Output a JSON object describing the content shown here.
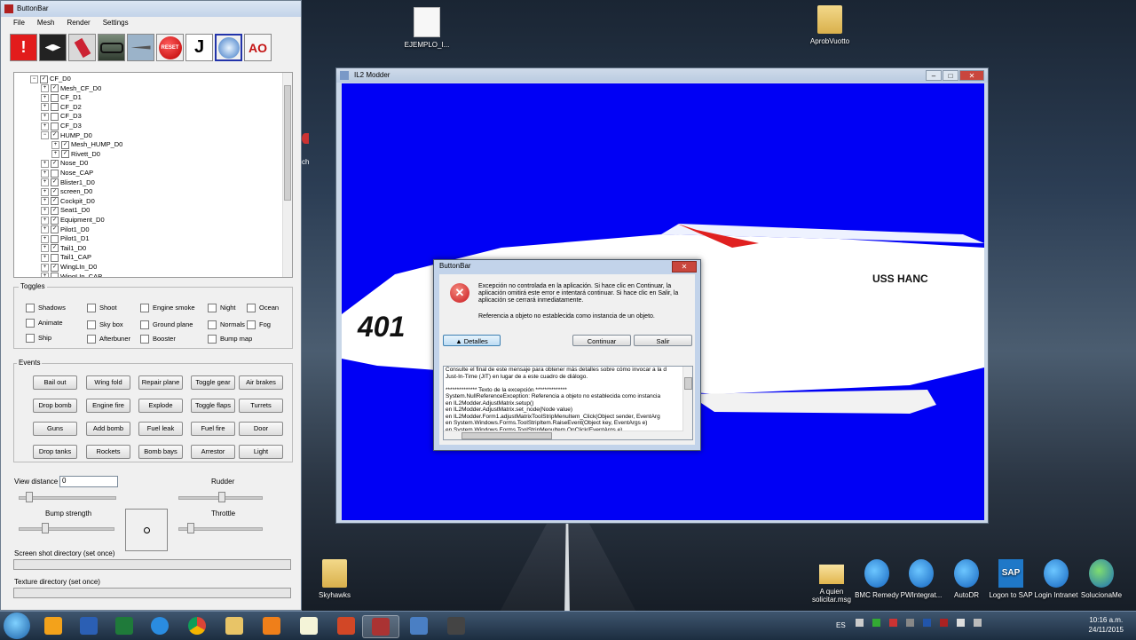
{
  "desktop": {
    "icons": [
      {
        "label": "EJEMPLO_I...",
        "kind": "file"
      },
      {
        "label": "AprobVuotto",
        "kind": "folder"
      },
      {
        "label": "Skyhawks",
        "kind": "folder"
      },
      {
        "label": "A quien solicitar.msg",
        "kind": "mail"
      },
      {
        "label": "BMC Remedy",
        "kind": "ie"
      },
      {
        "label": "PWIntegrat...",
        "kind": "ie"
      },
      {
        "label": "AutoDR",
        "kind": "ie"
      },
      {
        "label": "Logon to SAP",
        "kind": "sap"
      },
      {
        "label": "Login Intranet",
        "kind": "ie"
      },
      {
        "label": "SolucionaMe",
        "kind": "globe"
      }
    ],
    "partial_label": "ch"
  },
  "buttonbar": {
    "title": "ButtonBar",
    "menu": [
      "File",
      "Mesh",
      "Render",
      "Settings"
    ],
    "toolbar_labels": {
      "reset": "RESET",
      "ao": "AO"
    },
    "tree": [
      {
        "label": "CF_D0",
        "checked": true,
        "expanded": true,
        "level": 0
      },
      {
        "label": "Mesh_CF_D0",
        "checked": true,
        "level": 1
      },
      {
        "label": "CF_D1",
        "checked": false,
        "level": 1
      },
      {
        "label": "CF_D2",
        "checked": false,
        "level": 1
      },
      {
        "label": "CF_D3",
        "checked": false,
        "level": 1
      },
      {
        "label": "CF_D3",
        "checked": false,
        "level": 1
      },
      {
        "label": "HUMP_D0",
        "checked": true,
        "expanded": true,
        "level": 1
      },
      {
        "label": "Mesh_HUMP_D0",
        "checked": true,
        "level": 2
      },
      {
        "label": "Rivett_D0",
        "checked": true,
        "level": 2
      },
      {
        "label": "Nose_D0",
        "checked": true,
        "level": 1
      },
      {
        "label": "Nose_CAP",
        "checked": false,
        "level": 1
      },
      {
        "label": "Blister1_D0",
        "checked": true,
        "level": 1
      },
      {
        "label": "screen_D0",
        "checked": true,
        "level": 1
      },
      {
        "label": "Cockpit_D0",
        "checked": true,
        "level": 1
      },
      {
        "label": "Seat1_D0",
        "checked": true,
        "level": 1
      },
      {
        "label": "Equipment_D0",
        "checked": true,
        "level": 1
      },
      {
        "label": "Pilot1_D0",
        "checked": true,
        "level": 1
      },
      {
        "label": "Pilot1_D1",
        "checked": false,
        "level": 1
      },
      {
        "label": "Tail1_D0",
        "checked": true,
        "level": 1
      },
      {
        "label": "Tail1_CAP",
        "checked": false,
        "level": 1
      },
      {
        "label": "WingLIn_D0",
        "checked": true,
        "level": 1
      },
      {
        "label": "WingLIn_CAP",
        "checked": false,
        "level": 1
      }
    ],
    "toggles_title": "Toggles",
    "toggles": [
      "Shadows",
      "Shoot",
      "Engine smoke",
      "Night",
      "Ocean",
      "Animate",
      "Sky box",
      "Ground plane",
      "Normals",
      "Fog",
      "Ship",
      "Afterbuner",
      "Booster",
      "Bump map"
    ],
    "events_title": "Events",
    "events": [
      "Bail out",
      "Wing fold",
      "Repair plane",
      "Toggle gear",
      "Air brakes",
      "Drop bomb",
      "Engine fire",
      "Explode",
      "Toggle flaps",
      "Turrets",
      "Guns",
      "Add bomb",
      "Fuel leak",
      "Fuel fire",
      "Door",
      "Drop tanks",
      "Rockets",
      "Bomb bays",
      "Arrestor",
      "Light"
    ],
    "view_distance_label": "View distance",
    "view_distance_value": "0",
    "rudder_label": "Rudder",
    "bump_strength_label": "Bump strength",
    "throttle_label": "Throttle",
    "screenshot_dir_label": "Screen shot directory (set once)",
    "texture_dir_label": "Texture directory (set once)"
  },
  "il2": {
    "title": "IL2 Modder",
    "viewport_color": "#0000f5",
    "text_401": "401",
    "text_uss": "USS HANC"
  },
  "dialog": {
    "title": "ButtonBar",
    "message": "Excepción no controlada en la aplicación. Si hace clic en Continuar, la aplicación omitirá este error e intentará continuar. Si hace clic en Salir, la aplicación se cerrará inmediatamente.",
    "message2": "Referencia a objeto no establecida como instancia de un objeto.",
    "details_button": "Detalles",
    "continue_button": "Continuar",
    "exit_button": "Salir",
    "details_lines": [
      "Consulte el final de este mensaje para obtener más detalles sobre cómo invocar a la d",
      "Just-In-Time (JIT) en lugar de a este cuadro de diálogo.",
      "",
      "************** Texto de la excepción **************",
      "System.NullReferenceException: Referencia a objeto no establecida como instancia",
      "   en IL2Modder.AdjustMatrix.setup()",
      "   en IL2Modder.AdjustMatrix.set_node(Node value)",
      "   en IL2Modder.Form1.adjustMatrixToolStripMenuItem_Click(Object sender, EventArg",
      "   en System.Windows.Forms.ToolStripItem.RaiseEvent(Object key, EventArgs e)",
      "   en System.Windows.Forms.ToolStripMenuItem.OnClick(EventArgs e)"
    ]
  },
  "taskbar": {
    "language": "ES",
    "time": "10:16 a.m.",
    "date": "24/11/2015",
    "apps": [
      "outlook",
      "word",
      "excel",
      "internet-explorer",
      "chrome",
      "explorer",
      "media-player",
      "notepad",
      "powerpoint",
      "il2-modder",
      "remote",
      "il2"
    ]
  }
}
